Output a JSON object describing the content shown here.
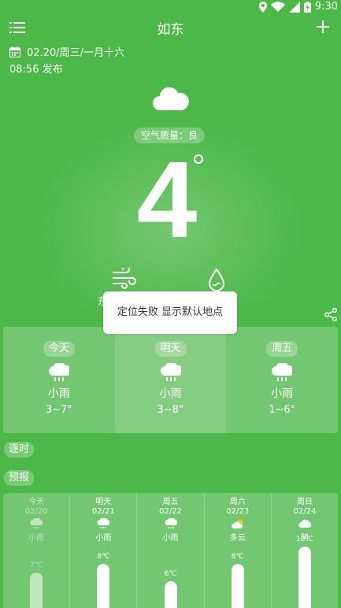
{
  "status_bar": {
    "time": "9:30"
  },
  "header": {
    "title": "如东"
  },
  "date_line": "02.20/周三/一月十六",
  "publish_time": "08:56 发布",
  "air_quality": "空气质量：良",
  "current_temp": "4",
  "wind_label_partial": "东",
  "toast_message": "定位失败 显示默认地点",
  "forecast_cards": [
    {
      "day": "今天",
      "condition": "小雨",
      "range": "3~7°",
      "icon": "cloud-rain-icon"
    },
    {
      "day": "明天",
      "condition": "小雨",
      "range": "3~8°",
      "icon": "cloud-rain-icon"
    },
    {
      "day": "周五",
      "condition": "小雨",
      "range": "1~6°",
      "icon": "cloud-rain-icon"
    }
  ],
  "hourly_label": "逐时",
  "forecast_label": "预报",
  "daily_table": [
    {
      "day": "今天",
      "date": "02/20",
      "condition": "小雨",
      "high": "7℃",
      "high_value": 7,
      "icon": "cloud-rain-icon"
    },
    {
      "day": "明天",
      "date": "02/21",
      "condition": "小雨",
      "high": "8℃",
      "high_value": 8,
      "icon": "cloud-rain-icon"
    },
    {
      "day": "周五",
      "date": "02/22",
      "condition": "小雨",
      "high": "6℃",
      "high_value": 6,
      "icon": "cloud-rain-icon"
    },
    {
      "day": "周六",
      "date": "02/23",
      "condition": "多云",
      "high": "8℃",
      "high_value": 8,
      "icon": "partly-cloudy-icon"
    },
    {
      "day": "周日",
      "date": "02/24",
      "condition": "阴",
      "high": "10℃",
      "high_value": 10,
      "icon": "cloud-icon"
    }
  ],
  "colors": {
    "background": "#4cb848",
    "accent": "#ffffff",
    "toast_text": "#333333",
    "sun": "#f5c518"
  }
}
